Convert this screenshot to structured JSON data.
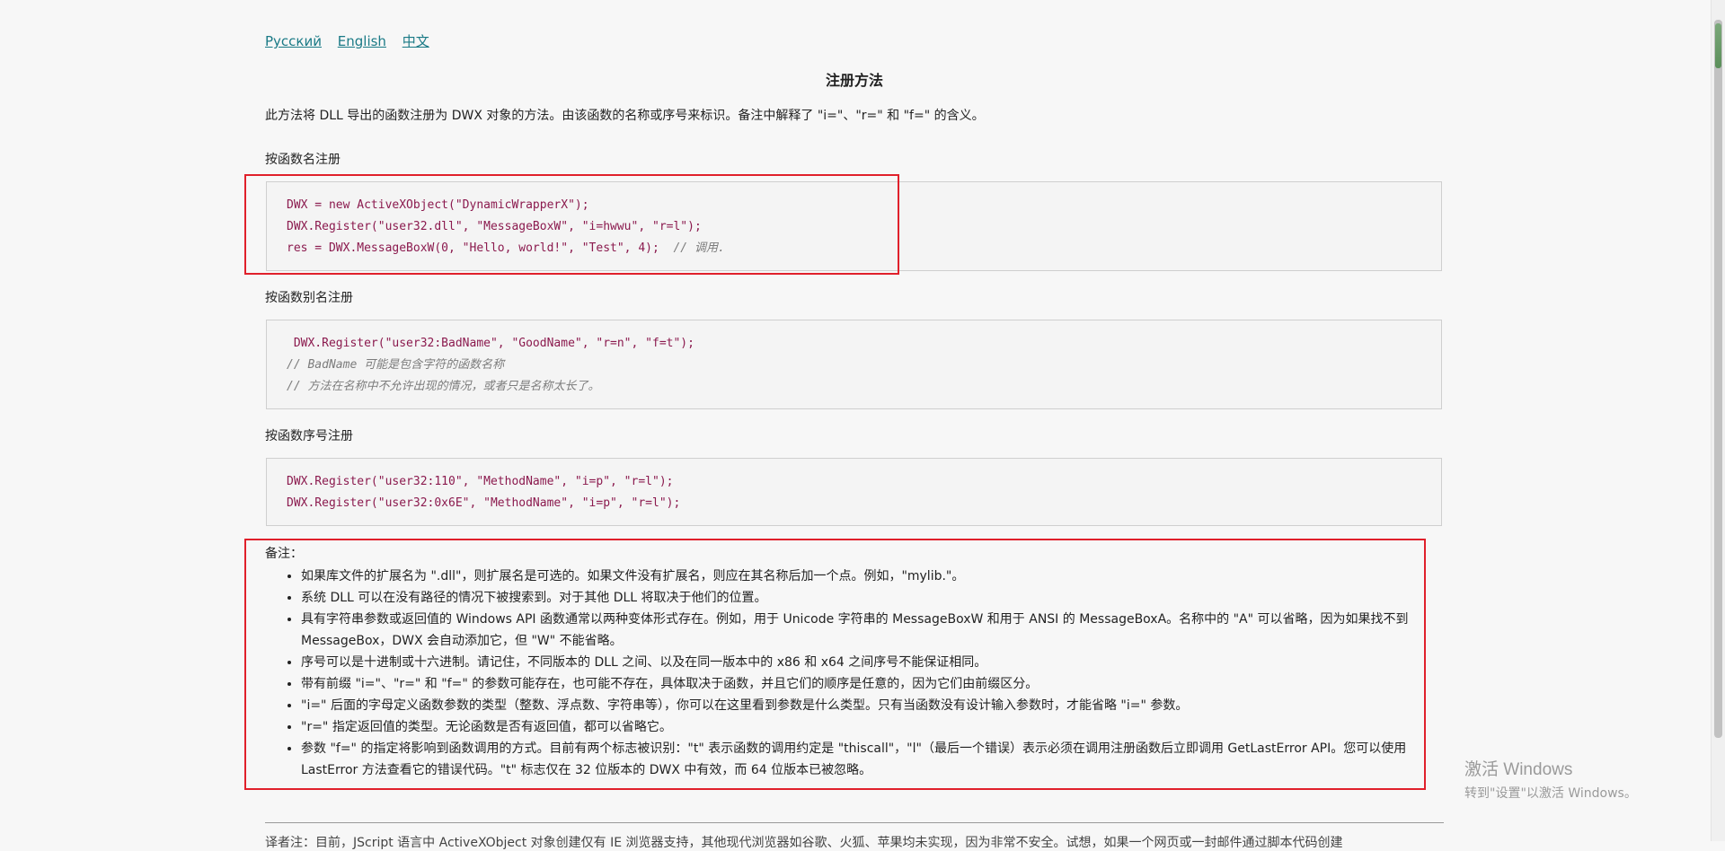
{
  "lang_links": [
    "Русский",
    "English",
    "中文"
  ],
  "title": "注册方法",
  "intro": "此方法将 DLL 导出的函数注册为 DWX 对象的方法。由该函数的名称或序号来标识。备注中解释了 \"i=\"、\"r=\" 和 \"f=\" 的含义。",
  "sections": [
    {
      "label": "按函数名注册",
      "code": [
        "DWX = new ActiveXObject(\"DynamicWrapperX\");",
        "DWX.Register(\"user32.dll\", \"MessageBoxW\", \"i=hwwu\", \"r=l\");",
        "res = DWX.MessageBoxW(0, \"Hello, world!\", \"Test\", 4);  "
      ],
      "inline_comment": "// 调用."
    },
    {
      "label": "按函数别名注册",
      "code": [
        " DWX.Register(\"user32:BadName\", \"GoodName\", \"r=n\", \"f=t\");"
      ],
      "comments": [
        "// BadName 可能是包含字符的函数名称",
        "// 方法在名称中不允许出现的情况，或者只是名称太长了。"
      ]
    },
    {
      "label": "按函数序号注册",
      "code": [
        "DWX.Register(\"user32:110\", \"MethodName\", \"i=p\", \"r=l\");",
        "DWX.Register(\"user32:0x6E\", \"MethodName\", \"i=p\", \"r=l\");"
      ]
    }
  ],
  "notes_label": "备注：",
  "notes": [
    "如果库文件的扩展名为 \".dll\"，则扩展名是可选的。如果文件没有扩展名，则应在其名称后加一个点。例如，\"mylib.\"。",
    "系统 DLL 可以在没有路径的情况下被搜索到。对于其他 DLL 将取决于他们的位置。",
    "具有字符串参数或返回值的 Windows API 函数通常以两种变体形式存在。例如，用于 Unicode 字符串的 MessageBoxW 和用于 ANSI 的 MessageBoxA。名称中的 \"A\" 可以省略，因为如果找不到 MessageBox，DWX 会自动添加它，但 \"W\" 不能省略。",
    "序号可以是十进制或十六进制。请记住，不同版本的 DLL 之间、以及在同一版本中的 x86 和 x64 之间序号不能保证相同。",
    "带有前缀 \"i=\"、\"r=\" 和 \"f=\" 的参数可能存在，也可能不存在，具体取决于函数，并且它们的顺序是任意的，因为它们由前缀区分。",
    "\"i=\" 后面的字母定义函数参数的类型（整数、浮点数、字符串等），你可以在这里看到参数是什么类型。只有当函数没有设计输入参数时，才能省略 \"i=\" 参数。",
    "\"r=\" 指定返回值的类型。无论函数是否有返回值，都可以省略它。",
    "参数 \"f=\" 的指定将影响到函数调用的方式。目前有两个标志被识别：\"t\" 表示函数的调用约定是 \"thiscall\"，\"l\"（最后一个错误）表示必须在调用注册函数后立即调用 GetLastError API。您可以使用 LastError 方法查看它的错误代码。\"t\" 标志仅在 32 位版本的 DWX 中有效，而 64 位版本已被忽略。"
  ],
  "footnote": "译者注：目前，JScript 语言中 ActiveXObject 对象创建仅有 IE 浏览器支持，其他现代浏览器如谷歌、火狐、苹果均未实现，因为非常不安全。试想，如果一个网页或一封邮件通过脚本代码创建",
  "watermark": {
    "title": "激活 Windows",
    "subtitle": "转到\"设置\"以激活 Windows。"
  }
}
